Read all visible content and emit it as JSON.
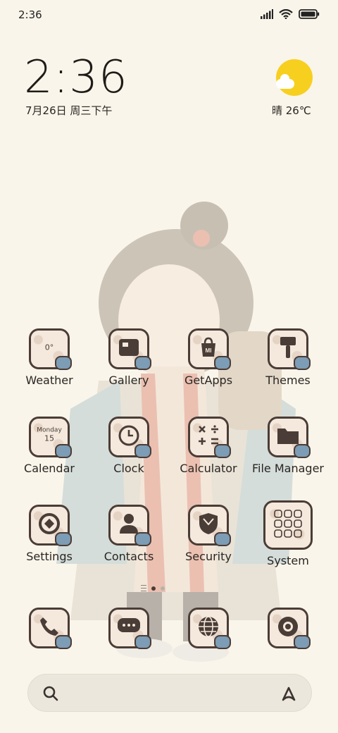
{
  "status_bar": {
    "time": "2:36",
    "icons": [
      "signal-icon",
      "wifi-icon",
      "battery-icon"
    ]
  },
  "clock_widget": {
    "time": "2:36",
    "date": "7月26日 周三下午"
  },
  "weather_widget": {
    "summary": "晴 26℃",
    "icon": "sun-cloud-icon"
  },
  "apps": [
    {
      "label": "Weather",
      "icon": "weather-icon",
      "icon_text": "0°"
    },
    {
      "label": "Gallery",
      "icon": "gallery-icon"
    },
    {
      "label": "GetApps",
      "icon": "getapps-icon",
      "icon_text": "MI"
    },
    {
      "label": "Themes",
      "icon": "themes-brush-icon"
    },
    {
      "label": "Calendar",
      "icon": "calendar-icon",
      "icon_text": "Monday",
      "icon_text2": "15"
    },
    {
      "label": "Clock",
      "icon": "clock-icon"
    },
    {
      "label": "Calculator",
      "icon": "calculator-icon"
    },
    {
      "label": "File Manager",
      "icon": "folder-icon"
    },
    {
      "label": "Settings",
      "icon": "settings-icon"
    },
    {
      "label": "Contacts",
      "icon": "contacts-icon"
    },
    {
      "label": "Security",
      "icon": "security-shield-icon"
    },
    {
      "label": "System",
      "icon": "system-folder-icon"
    }
  ],
  "page_indicator": {
    "pages": 2,
    "current": 1
  },
  "dock": [
    {
      "name": "phone",
      "icon": "phone-icon"
    },
    {
      "name": "messages",
      "icon": "messages-icon"
    },
    {
      "name": "browser",
      "icon": "browser-globe-icon"
    },
    {
      "name": "camera",
      "icon": "camera-icon"
    }
  ],
  "search_bar": {
    "left_icon": "search-icon",
    "right_icon": "assistant-icon"
  },
  "colors": {
    "background": "#faf5ea",
    "icon_border": "#4a3c36",
    "sun": "#f7cf1f",
    "badge": "#7d9cb5"
  }
}
